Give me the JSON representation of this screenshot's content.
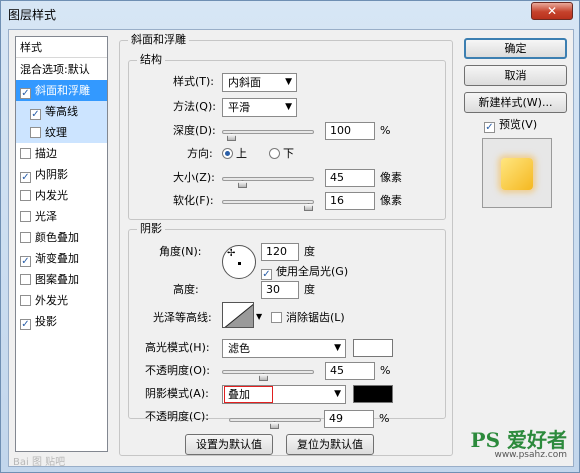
{
  "window": {
    "title": "图层样式",
    "close_glyph": "✕"
  },
  "style_list": {
    "header": "样式",
    "items": [
      {
        "label": "混合选项:默认",
        "check": null,
        "state": "plain"
      },
      {
        "label": "斜面和浮雕",
        "check": true,
        "state": "selected"
      },
      {
        "label": "等高线",
        "check": true,
        "state": "sub"
      },
      {
        "label": "纹理",
        "check": false,
        "state": "sub"
      },
      {
        "label": "描边",
        "check": false,
        "state": "plain"
      },
      {
        "label": "内阴影",
        "check": true,
        "state": "plain"
      },
      {
        "label": "内发光",
        "check": false,
        "state": "plain"
      },
      {
        "label": "光泽",
        "check": false,
        "state": "plain"
      },
      {
        "label": "颜色叠加",
        "check": false,
        "state": "plain"
      },
      {
        "label": "渐变叠加",
        "check": true,
        "state": "plain"
      },
      {
        "label": "图案叠加",
        "check": false,
        "state": "plain"
      },
      {
        "label": "外发光",
        "check": false,
        "state": "plain"
      },
      {
        "label": "投影",
        "check": true,
        "state": "plain"
      }
    ]
  },
  "bevel": {
    "group_title": "斜面和浮雕",
    "structure": {
      "group_title": "结构",
      "style_label": "样式(T):",
      "style_value": "内斜面",
      "technique_label": "方法(Q):",
      "technique_value": "平滑",
      "depth_label": "深度(D):",
      "depth_value": "100",
      "depth_unit": "%",
      "depth_fraction": 0.05,
      "direction_label": "方向:",
      "direction_up": "上",
      "direction_down": "下",
      "size_label": "大小(Z):",
      "size_value": "45",
      "size_unit": "像素",
      "size_fraction": 0.18,
      "soften_label": "软化(F):",
      "soften_value": "16",
      "soften_unit": "像素",
      "soften_fraction": 1.0
    },
    "shading": {
      "group_title": "阴影",
      "angle_label": "角度(N):",
      "angle_value": "120",
      "angle_unit": "度",
      "global_light_label": "使用全局光(G)",
      "global_light_checked": true,
      "altitude_label": "高度:",
      "altitude_value": "30",
      "altitude_unit": "度",
      "gloss_contour_label": "光泽等高线:",
      "anti_alias_label": "消除锯齿(L)",
      "anti_alias_checked": false,
      "highlight_mode_label": "高光模式(H):",
      "highlight_mode_value": "滤色",
      "highlight_color": "#ffffff",
      "highlight_opacity_label": "不透明度(O):",
      "highlight_opacity_value": "45",
      "highlight_opacity_unit": "%",
      "highlight_opacity_fraction": 0.45,
      "shadow_mode_label": "阴影模式(A):",
      "shadow_mode_value": "叠加",
      "shadow_color": "#000000",
      "shadow_opacity_label": "不透明度(C):",
      "shadow_opacity_value": "49",
      "shadow_opacity_unit": "%",
      "shadow_opacity_fraction": 0.49
    },
    "make_default": "设置为默认值",
    "reset_default": "复位为默认值"
  },
  "buttons": {
    "ok": "确定",
    "cancel": "取消",
    "new_style": "新建样式(W)...",
    "preview_label": "预览(V)",
    "preview_checked": true
  },
  "watermarks": {
    "baidu": "Bai 图 贴吧",
    "ps_logo_big": "PS 爱好者",
    "ps_logo_small": "www.psahz.com"
  }
}
